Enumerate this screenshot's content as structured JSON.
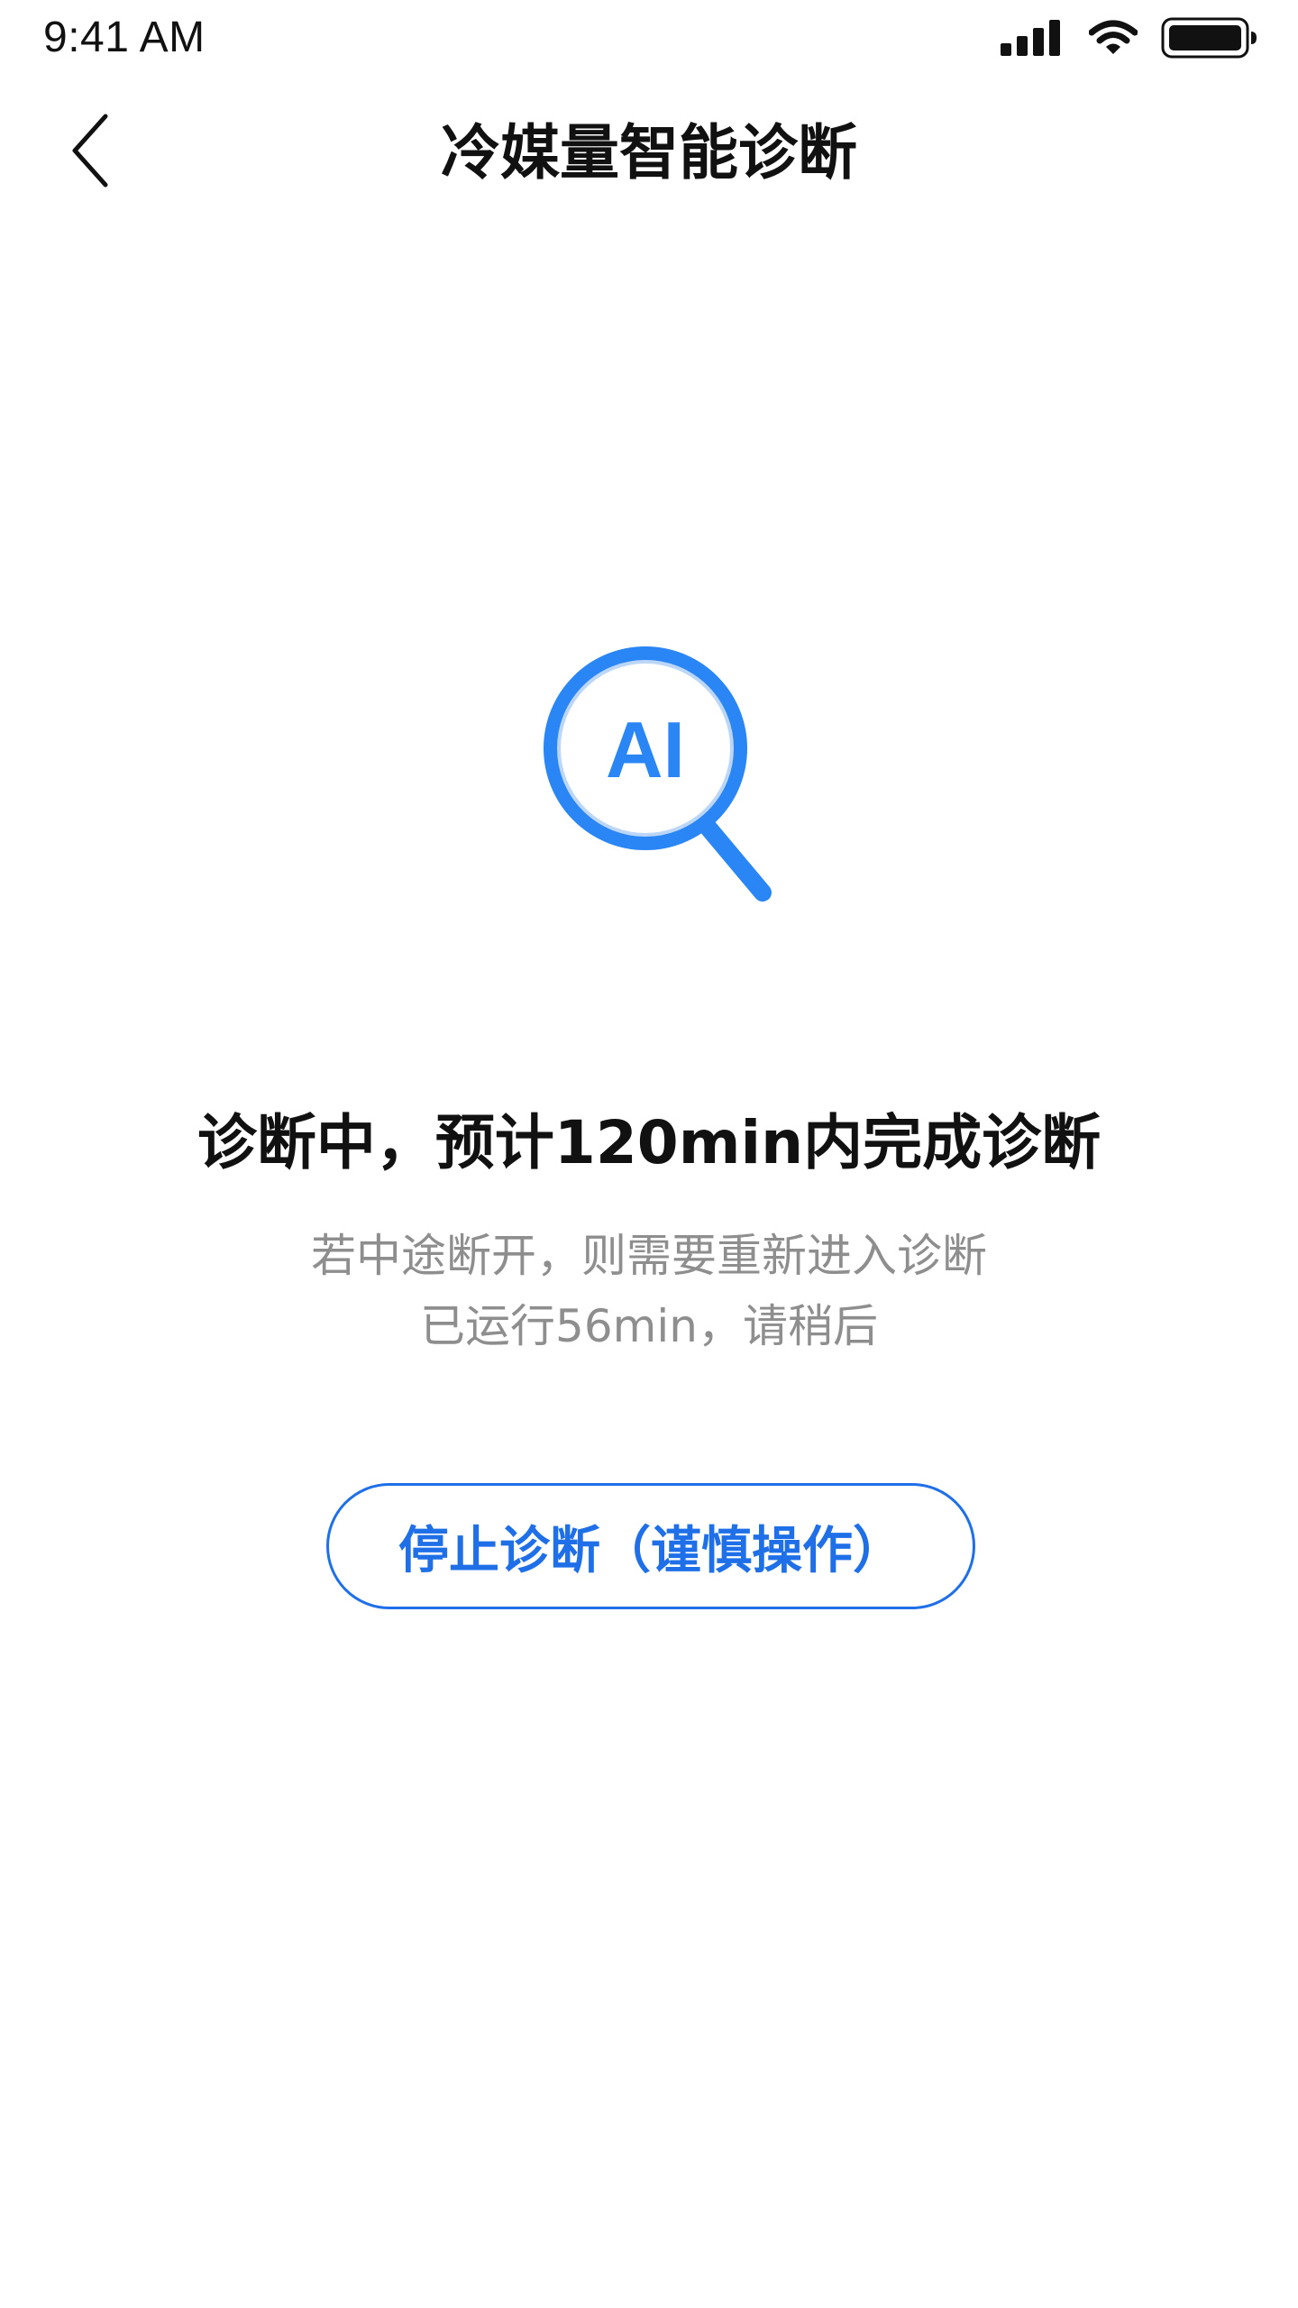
{
  "status_bar": {
    "time": "9:41 AM",
    "icons": [
      "signal-icon",
      "wifi-icon",
      "battery-icon"
    ],
    "battery_level": 0.85
  },
  "nav": {
    "back_icon": "chevron-left-icon",
    "title": "冷媒量智能诊断"
  },
  "illustration": {
    "icon": "magnifier-icon",
    "label": "AI"
  },
  "diagnosis": {
    "heading": "诊断中，预计120min内完成诊断",
    "desc_line1": "若中途断开，则需要重新进入诊断",
    "desc_line2": "已运行56min，请稍后"
  },
  "actions": {
    "stop_label": "停止诊断（谨慎操作）"
  },
  "colors": {
    "accent": "#1f6fe8",
    "icon_blue": "#2b86f5",
    "text_primary": "#111111",
    "text_secondary": "#8e8e8e",
    "background": "#ffffff"
  }
}
